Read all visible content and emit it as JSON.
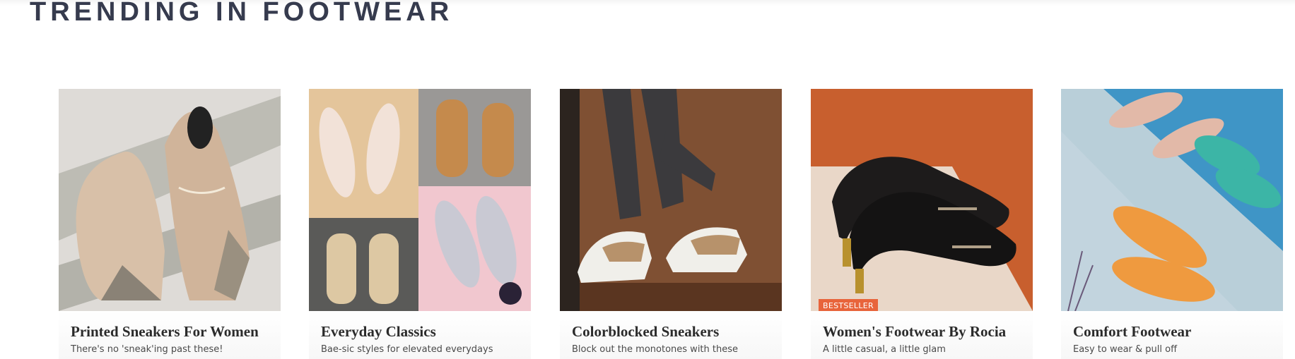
{
  "section": {
    "title": "TRENDING IN FOOTWEAR"
  },
  "cards": [
    {
      "title": "Printed Sneakers For Women",
      "subtitle": "There's no 'sneak'ing past these!"
    },
    {
      "title": "Everyday Classics",
      "subtitle": "Bae-sic styles for elevated everydays"
    },
    {
      "title": "Colorblocked Sneakers",
      "subtitle": "Block out the monotones with these"
    },
    {
      "title": "Women's Footwear By Rocia",
      "subtitle": "A little casual, a little glam",
      "badge": "BESTSELLER"
    },
    {
      "title": "Comfort Footwear",
      "subtitle": "Easy to wear & pull off"
    }
  ],
  "colors": {
    "title_text": "#363b4e",
    "badge_bg": "#e8643b"
  }
}
